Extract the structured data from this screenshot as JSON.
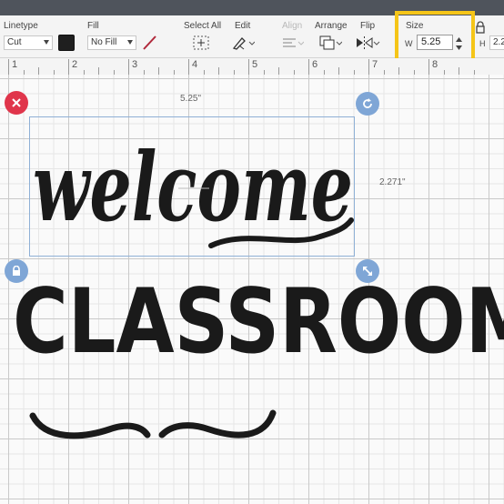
{
  "toolbar": {
    "linetype": {
      "label": "Linetype",
      "value": "Cut"
    },
    "fill": {
      "label": "Fill",
      "value": "No Fill"
    },
    "select_all": {
      "label": "Select All"
    },
    "edit": {
      "label": "Edit"
    },
    "align": {
      "label": "Align"
    },
    "arrange": {
      "label": "Arrange"
    },
    "flip": {
      "label": "Flip"
    },
    "size": {
      "label": "Size",
      "w_label": "W",
      "w_value": "5.25",
      "h_label": "H",
      "h_value": "2.2"
    }
  },
  "ruler": {
    "marks": [
      "1",
      "2",
      "3",
      "4",
      "5",
      "6",
      "7",
      "8"
    ]
  },
  "selection": {
    "width_label": "5.25\"",
    "height_label": "2.271\""
  },
  "canvas_text": {
    "welcome": "welcome",
    "classroom": "CLASSROOM"
  },
  "colors": {
    "accent_highlight": "#f5c518",
    "delete_handle": "#e0354b",
    "handle_blue": "#7fa6d6",
    "design_black": "#1a1a1a"
  }
}
